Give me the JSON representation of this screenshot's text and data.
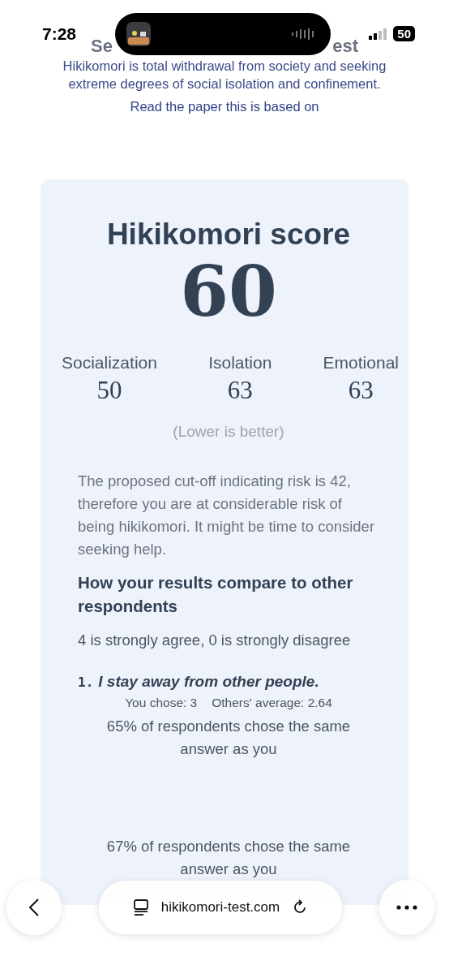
{
  "status_bar": {
    "time": "7:28",
    "battery": "50"
  },
  "header": {
    "title_fragments": [
      "Se",
      "est"
    ],
    "intro": "Hikikomori is total withdrawal from society and seeking extreme degrees of social isolation and confinement.",
    "paper_link": "Read the paper this is based on"
  },
  "result": {
    "title": "Hikikomori score",
    "score": "60",
    "subscores": [
      {
        "label": "Socialization",
        "value": "50"
      },
      {
        "label": "Isolation",
        "value": "63"
      },
      {
        "label": "Emotional",
        "value": "63"
      }
    ],
    "note": "(Lower is better)",
    "explanation": "The proposed cut-off indicating risk is 42, therefore you are at considerable risk of being hikikomori. It might be time to consider seeking help.",
    "compare_heading": "How your results compare to other respondents",
    "scale_note": "4 is strongly agree, 0 is strongly disagree",
    "questions": [
      {
        "number": "1.",
        "text": "I stay away from other people.",
        "you_chose": "You chose: 3",
        "average": "Others' average: 2.64",
        "same": "65% of respondents chose the same answer as you"
      },
      {
        "same": "67% of respondents chose the same answer as you"
      }
    ]
  },
  "browser_bar": {
    "url": "hikikomori-test.com"
  }
}
